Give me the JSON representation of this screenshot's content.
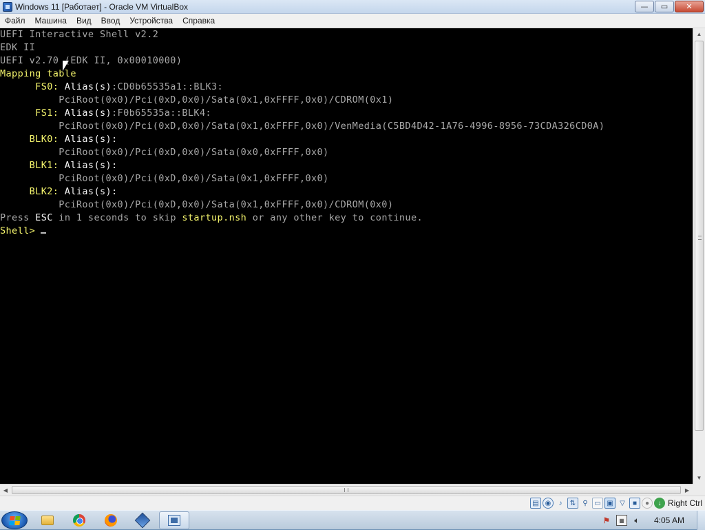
{
  "window": {
    "title": "Windows 11 [Работает] - Oracle VM VirtualBox",
    "minimize_glyph": "—",
    "maximize_glyph": "▭",
    "close_glyph": "✕"
  },
  "menu": {
    "items": [
      "Файл",
      "Машина",
      "Вид",
      "Ввод",
      "Устройства",
      "Справка"
    ]
  },
  "console": {
    "line1": "UEFI Interactive Shell v2.2",
    "line2": "EDK II",
    "line3": "UEFI v2.70 (EDK II, 0x00010000)",
    "mapping_header": "Mapping table",
    "fs0_label": "      FS0:",
    "fs0_alias": " Alias(s)",
    "fs0_alias_val": ":CD0b65535a1::BLK3:",
    "fs0_path": "          PciRoot(0x0)/Pci(0xD,0x0)/Sata(0x1,0xFFFF,0x0)/CDROM(0x1)",
    "fs1_label": "      FS1:",
    "fs1_alias": " Alias(s)",
    "fs1_alias_val": ":F0b65535a::BLK4:",
    "fs1_path": "          PciRoot(0x0)/Pci(0xD,0x0)/Sata(0x1,0xFFFF,0x0)/VenMedia(C5BD4D42-1A76-4996-8956-73CDA326CD0A)",
    "blk0_label": "     BLK0:",
    "blk0_alias": " Alias(s):",
    "blk0_path": "          PciRoot(0x0)/Pci(0xD,0x0)/Sata(0x0,0xFFFF,0x0)",
    "blk1_label": "     BLK1:",
    "blk1_alias": " Alias(s):",
    "blk1_path": "          PciRoot(0x0)/Pci(0xD,0x0)/Sata(0x1,0xFFFF,0x0)",
    "blk2_label": "     BLK2:",
    "blk2_alias": " Alias(s):",
    "blk2_path": "          PciRoot(0x0)/Pci(0xD,0x0)/Sata(0x1,0xFFFF,0x0)/CDROM(0x0)",
    "press_1": "Press ",
    "press_esc": "ESC",
    "press_2": " in 1 seconds to skip ",
    "press_file": "startup.nsh",
    "press_3": " or any other key to continue.",
    "prompt": "Shell>",
    "colors": {
      "yellow": "#f4f46c",
      "white": "#f2f2f2",
      "gray": "#a8a8a8",
      "background": "#000000"
    }
  },
  "statusbar": {
    "host_key": "Right Ctrl",
    "icons": [
      "hard-disk-icon",
      "optical-drive-icon",
      "audio-icon",
      "network-icon",
      "usb-icon",
      "shared-folders-icon",
      "display-icon",
      "video-capture-icon",
      "recording-icon",
      "mouse-integration-icon",
      "keyboard-capture-icon"
    ]
  },
  "taskbar": {
    "pinned": [
      "windows-explorer-icon",
      "chrome-icon",
      "firefox-icon",
      "virtualbox-icon",
      "vm-window-icon"
    ],
    "clock": "4:05 AM"
  }
}
